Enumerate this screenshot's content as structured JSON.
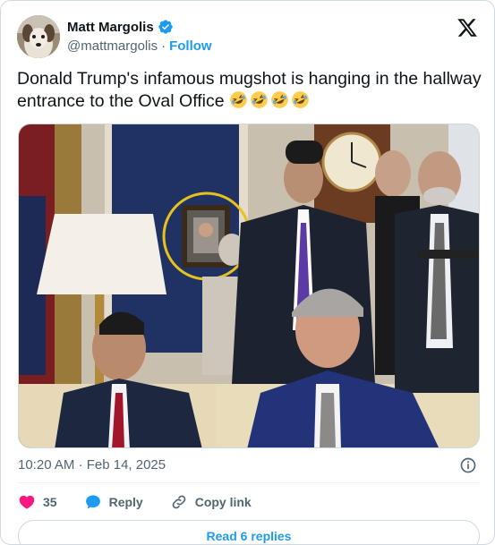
{
  "author": {
    "display_name": "Matt Margolis",
    "handle": "@mattmargolis",
    "separator": "·",
    "follow_label": "Follow"
  },
  "tweet": {
    "text": "Donald Trump's infamous mugshot is hanging in the hallway entrance to the Oval Office",
    "emojis": [
      "rolling-on-floor-laughing",
      "rolling-on-floor-laughing",
      "rolling-on-floor-laughing",
      "rolling-on-floor-laughing"
    ]
  },
  "media": {
    "description_icon": "photo"
  },
  "meta": {
    "timestamp": "10:20 AM · Feb 14, 2025"
  },
  "actions": {
    "like_count": "35",
    "reply_label": "Reply",
    "copy_link_label": "Copy link"
  },
  "replies": {
    "read_label": "Read 6 replies"
  },
  "colors": {
    "accent": "#1d9bf0",
    "like": "#f91880",
    "text_primary": "#0f1419",
    "text_secondary": "#536471",
    "border": "#cfd9de",
    "highlight_circle": "#e8c21a"
  }
}
